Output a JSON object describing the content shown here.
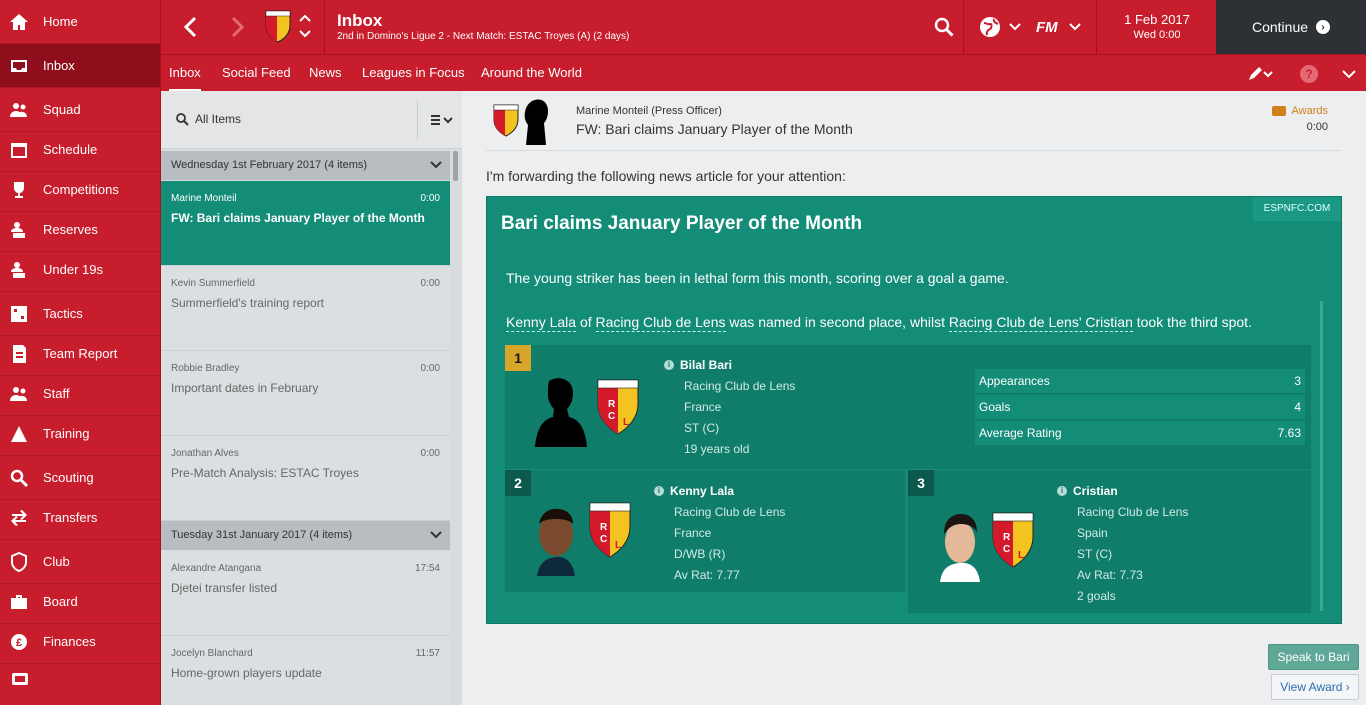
{
  "sidebar": {
    "items": [
      {
        "label": "Home",
        "icon": "home-icon"
      },
      {
        "label": "Inbox",
        "icon": "inbox-icon",
        "active": true
      },
      {
        "label": "Squad",
        "icon": "squad-icon"
      },
      {
        "label": "Schedule",
        "icon": "calendar-icon"
      },
      {
        "label": "Competitions",
        "icon": "trophy-icon"
      },
      {
        "label": "Reserves",
        "icon": "reserves-icon"
      },
      {
        "label": "Under 19s",
        "icon": "under19-icon"
      },
      {
        "label": "Tactics",
        "icon": "tactics-icon"
      },
      {
        "label": "Team Report",
        "icon": "report-icon"
      },
      {
        "label": "Staff",
        "icon": "staff-icon"
      },
      {
        "label": "Training",
        "icon": "training-icon"
      },
      {
        "label": "Scouting",
        "icon": "scouting-icon"
      },
      {
        "label": "Transfers",
        "icon": "transfers-icon"
      },
      {
        "label": "Club",
        "icon": "club-icon"
      },
      {
        "label": "Board",
        "icon": "board-icon"
      },
      {
        "label": "Finances",
        "icon": "finances-icon"
      }
    ]
  },
  "topbar": {
    "title": "Inbox",
    "subtitle": "2nd in Domino's Ligue 2 - Next Match: ESTAC Troyes (A) (2 days)",
    "date": "1 Feb 2017",
    "time": "Wed 0:00",
    "continue_label": "Continue"
  },
  "tabs": [
    "Inbox",
    "Social Feed",
    "News",
    "Leagues in Focus",
    "Around the World"
  ],
  "list": {
    "filter_label": "All Items",
    "groups": [
      {
        "label": "Wednesday 1st February 2017 (4 items)"
      },
      {
        "label": "Tuesday 31st January 2017 (4 items)"
      }
    ],
    "messages": [
      {
        "from": "Marine Monteil",
        "time": "0:00",
        "subject": "FW: Bari claims January Player of the Month"
      },
      {
        "from": "Kevin Summerfield",
        "time": "0:00",
        "subject": "Summerfield's training report"
      },
      {
        "from": "Robbie Bradley",
        "time": "0:00",
        "subject": "Important dates in February"
      },
      {
        "from": "Jonathan Alves",
        "time": "0:00",
        "subject": "Pre-Match Analysis: ESTAC Troyes"
      },
      {
        "from": "Alexandre Atangana",
        "time": "17:54",
        "subject": "Djetei transfer listed"
      },
      {
        "from": "Jocelyn Blanchard",
        "time": "11:57",
        "subject": "Home-grown players update"
      }
    ]
  },
  "message": {
    "sender": "Marine Monteil  (Press Officer)",
    "subject": "FW: Bari claims January Player of the Month",
    "tag": "Awards",
    "time": "0:00",
    "intro": "I'm forwarding the following news article for your attention:",
    "article": {
      "source": "ESPNFC.COM",
      "title": "Bari claims January Player of the Month",
      "para1": "The young striker has been in lethal form this month, scoring over a goal a game.",
      "p2_a": "Kenny Lala",
      "p2_b": " of ",
      "p2_c": "Racing Club de Lens",
      "p2_d": " was named in second place, whilst ",
      "p2_e": "Racing Club de Lens' Cristian",
      "p2_f": " took the third spot."
    },
    "winner": {
      "rank": "1",
      "name": "Bilal Bari",
      "club": "Racing Club de Lens",
      "nation": "France",
      "position": "ST (C)",
      "age": "19 years old",
      "stats": [
        {
          "label": "Appearances",
          "value": "3"
        },
        {
          "label": "Goals",
          "value": "4"
        },
        {
          "label": "Average Rating",
          "value": "7.63"
        }
      ]
    },
    "second": {
      "rank": "2",
      "name": "Kenny Lala",
      "club": "Racing Club de Lens",
      "nation": "France",
      "position": "D/WB (R)",
      "rating": "Av Rat: 7.77"
    },
    "third": {
      "rank": "3",
      "name": "Cristian",
      "club": "Racing Club de Lens",
      "nation": "Spain",
      "position": "ST (C)",
      "rating": "Av Rat: 7.73",
      "goals": "2 goals"
    },
    "buttons": {
      "speak": "Speak to Bari",
      "view": "View Award"
    }
  },
  "colors": {
    "brand_red": "#c71d2c",
    "article_green": "#138c78",
    "dark": "#2d3035"
  }
}
